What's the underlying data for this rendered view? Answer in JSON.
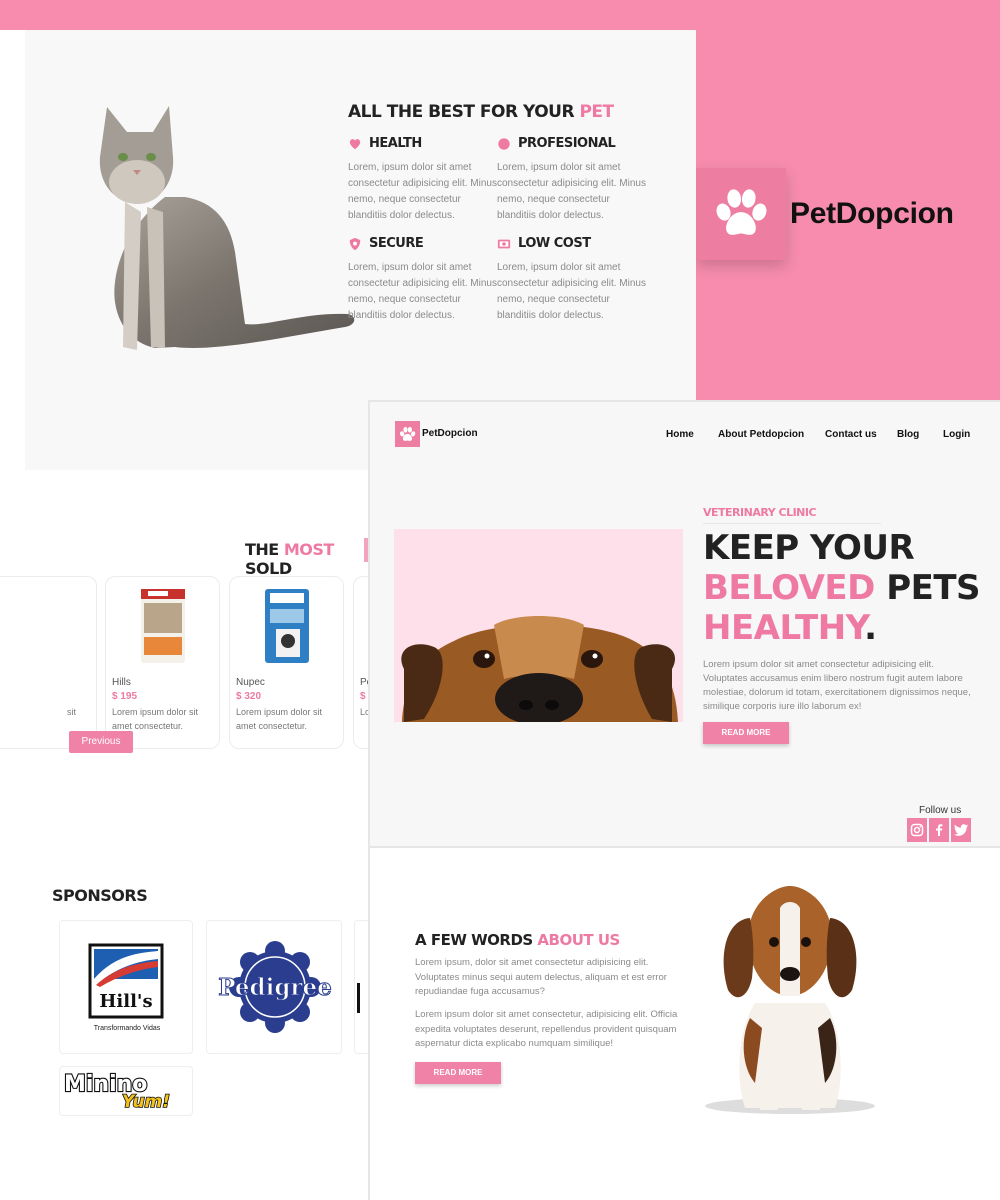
{
  "brand": {
    "name": "PetDopcion"
  },
  "features": {
    "heading_main": "ALL THE BEST FOR YOUR ",
    "heading_accent": "PET",
    "items": [
      {
        "title": "HEALTH",
        "icon": "heart-icon",
        "text": "Lorem, ipsum dolor sit amet consectetur adipisicing elit. Minus nemo, neque consectetur blanditiis dolor delectus."
      },
      {
        "title": "PROFESIONAL",
        "icon": "circle-badge-icon",
        "text": "Lorem, ipsum dolor sit amet consectetur adipisicing elit. Minus nemo, neque consectetur blanditiis dolor delectus."
      },
      {
        "title": "SECURE",
        "icon": "shield-icon",
        "text": "Lorem, ipsum dolor sit amet consectetur adipisicing elit. Minus nemo, neque consectetur blanditiis dolor delectus."
      },
      {
        "title": "LOW COST",
        "icon": "money-icon",
        "text": "Lorem, ipsum dolor sit amet consectetur adipisicing elit. Minus nemo, neque consectetur blanditiis dolor delectus."
      }
    ]
  },
  "most_sold": {
    "heading_1": "THE ",
    "heading_accent": "MOST",
    "heading_2": " SOLD",
    "partial_left_text": "sit",
    "products": [
      {
        "name": "Hills",
        "price": "$ 195",
        "desc": "Lorem ipsum dolor sit amet consectetur."
      },
      {
        "name": "Nupec",
        "price": "$ 320",
        "desc": "Lorem ipsum dolor sit amet consectetur."
      },
      {
        "name": "Pe",
        "price": "$",
        "desc": "Lo"
      }
    ],
    "previous_label": "Previous"
  },
  "sponsors": {
    "heading": "SPONSORS",
    "hills_text": "Hill's",
    "hills_tagline": "Transformando Vidas",
    "pedigree_text": "Pedigree",
    "minino_text": "Minino",
    "minino_sub": "Yum!"
  },
  "hero": {
    "nav_brand": "PetDopcion",
    "nav": [
      "Home",
      "About Petdopcion",
      "Contact us",
      "Blog",
      "Login"
    ],
    "eyebrow": "VETERINARY CLINIC",
    "title_l1": "KEEP YOUR",
    "title_accent": "BELOVED",
    "title_l2_rest": " PETS",
    "title_l3_accent": "HEALTHY",
    "title_dot": ".",
    "paragraph": "Lorem ipsum dolor sit amet consectetur adipisicing elit. Voluptates accusamus enim libero nostrum fugit autem labore molestiae, dolorum id totam, exercitationem dignissimos neque, similique corporis iure illo laborum ex!",
    "read_more": "READ MORE",
    "follow": "Follow us",
    "social": [
      "instagram-icon",
      "facebook-icon",
      "twitter-icon"
    ]
  },
  "about": {
    "heading_1": "A FEW WORDS ",
    "heading_accent": "ABOUT US",
    "p1": "Lorem ipsum, dolor sit amet consectetur adipisicing elit. Voluptates minus sequi autem delectus, aliquam et est error repudiandae fuga accusamus?",
    "p2": "Lorem ipsum dolor sit amet consectetur, adipisicing elit. Officia expedita voluptates deserunt, repellendus provident quisquam aspernatur dicta explicabo numquam similique!",
    "read_more": "READ MORE"
  },
  "colors": {
    "accent": "#ee7aa3",
    "band": "#f78cae",
    "panel": "#f8f8f8"
  }
}
